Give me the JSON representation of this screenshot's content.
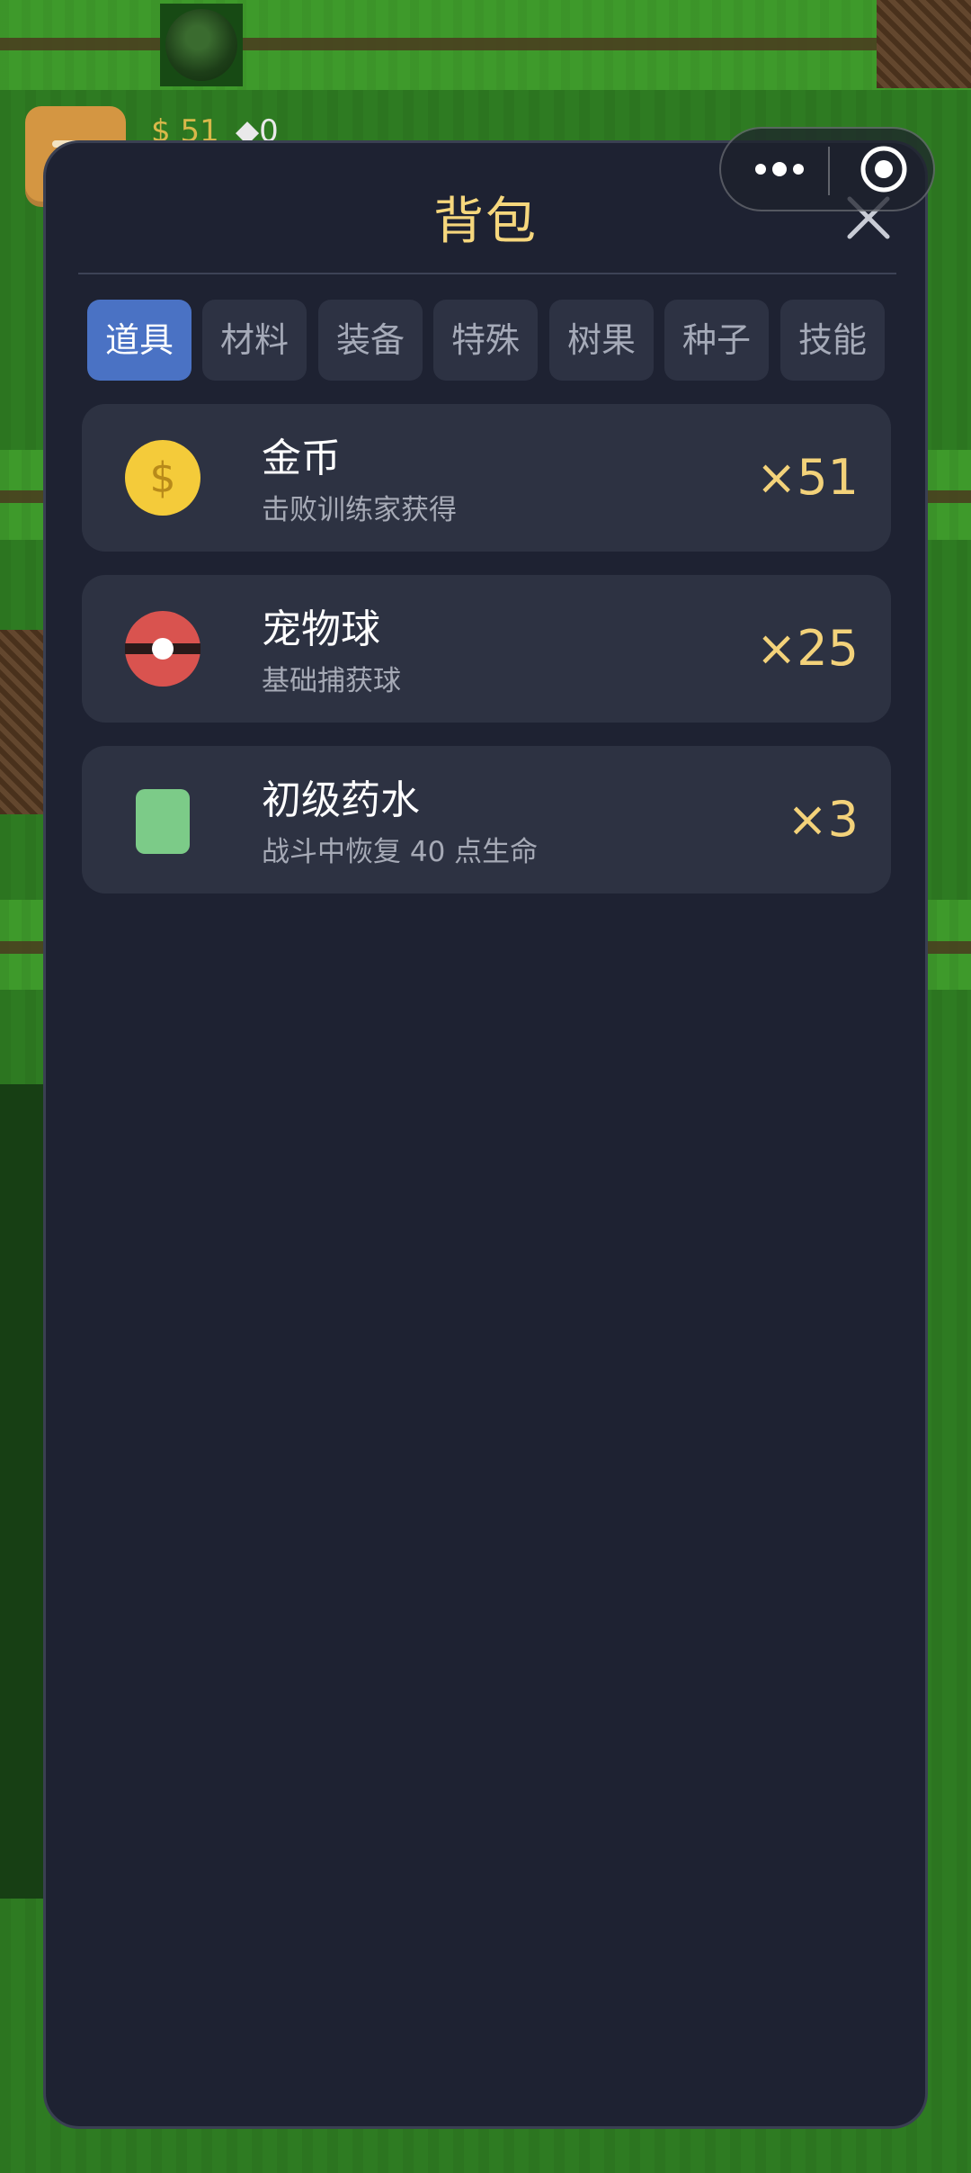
{
  "hud": {
    "coins": "51",
    "gems": "0"
  },
  "modal": {
    "title": "背包",
    "tabs": [
      {
        "label": "道具",
        "active": true
      },
      {
        "label": "材料",
        "active": false
      },
      {
        "label": "装备",
        "active": false
      },
      {
        "label": "特殊",
        "active": false
      },
      {
        "label": "树果",
        "active": false
      },
      {
        "label": "种子",
        "active": false
      },
      {
        "label": "技能",
        "active": false
      }
    ],
    "items": [
      {
        "name": "金币",
        "desc": "击败训练家获得",
        "count": "×51",
        "icon": "coin-icon"
      },
      {
        "name": "宠物球",
        "desc": "基础捕获球",
        "count": "×25",
        "icon": "pet-ball-icon"
      },
      {
        "name": "初级药水",
        "desc": "战斗中恢复 40 点生命",
        "count": "×3",
        "icon": "potion-icon"
      }
    ]
  },
  "colors": {
    "title": "#f6d77d",
    "active_tab": "#4a72c4",
    "count": "#f3d27a",
    "coin": "#f4cb3a",
    "pet_ball": "#d9534f",
    "potion": "#7ccb88"
  }
}
